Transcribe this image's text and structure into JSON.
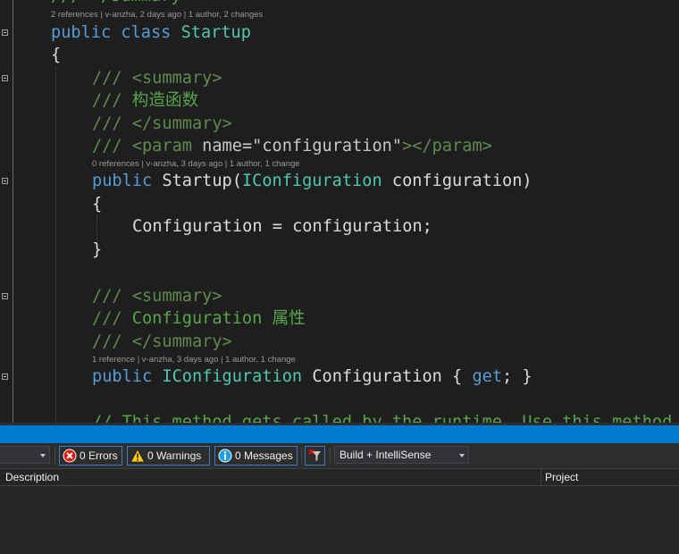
{
  "codelens": {
    "class_refs": "2 references | v-anzha, 2 days ago | 1 author, 2 changes",
    "ctor_refs": "0 references | v-anzha, 3 days ago | 1 author, 1 change",
    "prop_refs": "1 reference | v-anzha, 3 days ago | 1 author, 1 change"
  },
  "code": {
    "top_partial": "/// </summary>",
    "kw_public": "public",
    "kw_class": "class",
    "class_name": "Startup",
    "brace_open": "{",
    "brace_close": "}",
    "doc_prefix": "///",
    "tag_summary_open": "<summary>",
    "tag_summary_close": "</summary>",
    "ctor_summary": "构造函数",
    "tag_param_open": "<param",
    "attr_name": "name",
    "attr_eq_quote": "=\"",
    "param_value": "configuration",
    "attr_close_quote": "\"",
    "tag_param_end": "></param>",
    "ctor_name": "Startup(",
    "param_type": "IConfiguration",
    "param_name": "configuration)",
    "assign_stmt": "Configuration = configuration;",
    "prop_summary": "Configuration 属性",
    "prop_type": "IConfiguration",
    "prop_name": "Configuration { ",
    "kw_get": "get",
    "prop_end": "; }",
    "bottom_comment": "// This method gets called by the runtime. Use this method"
  },
  "error_list": {
    "errors_label": "0 Errors",
    "warnings_label": "0 Warnings",
    "messages_label": "0 Messages",
    "scope_filter": "Build + IntelliSense",
    "columns": [
      "Description",
      "Project"
    ]
  },
  "colors": {
    "keyword": "#569cd6",
    "type": "#4ec9b0",
    "comment": "#57a64a",
    "string": "#d69d85",
    "accent_bar": "#007acc"
  }
}
